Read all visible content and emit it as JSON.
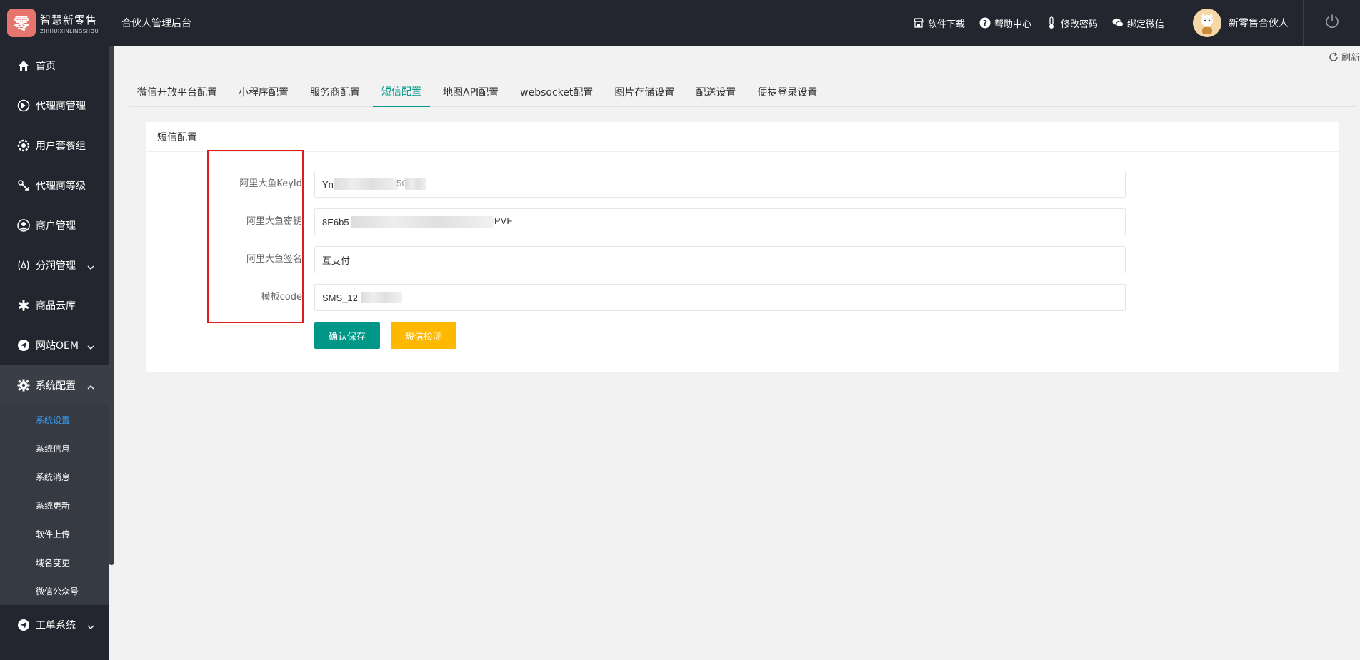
{
  "header": {
    "logo_mark": "零",
    "logo_cn": "智慧新零售",
    "logo_en": "ZHIHUIXINLINGSHOU",
    "system_title": "合伙人管理后台",
    "links": [
      {
        "label": "软件下载",
        "icon": "store-icon"
      },
      {
        "label": "帮助中心",
        "icon": "help-icon"
      },
      {
        "label": "修改密码",
        "icon": "thermometer-icon"
      },
      {
        "label": "绑定微信",
        "icon": "wechat-icon"
      }
    ],
    "user_name": "新零售合伙人"
  },
  "sidebar": {
    "items": [
      {
        "label": "首页",
        "icon": "home-icon"
      },
      {
        "label": "代理商管理",
        "icon": "agent-icon"
      },
      {
        "label": "用户套餐组",
        "icon": "package-icon"
      },
      {
        "label": "代理商等级",
        "icon": "level-icon"
      },
      {
        "label": "商户管理",
        "icon": "user-icon"
      },
      {
        "label": "分润管理",
        "icon": "profit-icon"
      },
      {
        "label": "商品云库",
        "icon": "asterisk-icon"
      },
      {
        "label": "网站OEM",
        "icon": "send-icon"
      },
      {
        "label": "系统配置",
        "icon": "gear-icon"
      }
    ],
    "sub_items": [
      "系统设置",
      "系统信息",
      "系统消息",
      "系统更新",
      "软件上传",
      "域名变更",
      "微信公众号"
    ],
    "bottom_item": {
      "label": "工单系统",
      "icon": "send-icon"
    }
  },
  "main": {
    "refresh_label": "刷新",
    "tabs": [
      "微信开放平台配置",
      "小程序配置",
      "服务商配置",
      "短信配置",
      "地图API配置",
      "websocket配置",
      "图片存储设置",
      "配送设置",
      "便捷登录设置"
    ],
    "active_tab": "短信配置",
    "card_title": "短信配置",
    "form": [
      {
        "label": "阿里大鱼KeyId",
        "value": "Yn"
      },
      {
        "label": "阿里大鱼密钥",
        "value": "8E6b5"
      },
      {
        "label": "阿里大鱼签名",
        "value": "互支付"
      },
      {
        "label": "模板code",
        "value": "SMS_12"
      }
    ],
    "value_suffix": {
      "keyid": "5C",
      "secret": "PVF"
    },
    "save_button": "确认保存",
    "test_button": "短信检测"
  }
}
